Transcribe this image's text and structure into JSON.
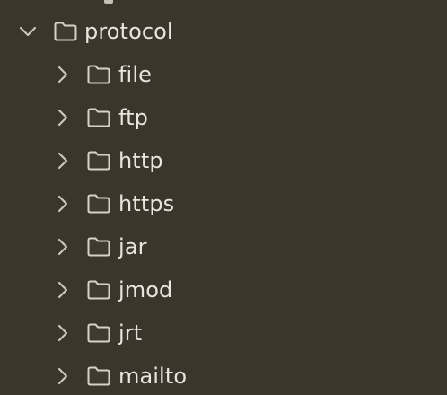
{
  "parent_folder": {
    "name": "protocol",
    "expanded": true,
    "icon": "folder-icon",
    "toggle_icon": "chevron-down-icon"
  },
  "children": [
    {
      "name": "file",
      "expanded": false,
      "icon": "folder-icon",
      "toggle_icon": "chevron-right-icon"
    },
    {
      "name": "ftp",
      "expanded": false,
      "icon": "folder-icon",
      "toggle_icon": "chevron-right-icon"
    },
    {
      "name": "http",
      "expanded": false,
      "icon": "folder-icon",
      "toggle_icon": "chevron-right-icon"
    },
    {
      "name": "https",
      "expanded": false,
      "icon": "folder-icon",
      "toggle_icon": "chevron-right-icon"
    },
    {
      "name": "jar",
      "expanded": false,
      "icon": "folder-icon",
      "toggle_icon": "chevron-right-icon"
    },
    {
      "name": "jmod",
      "expanded": false,
      "icon": "folder-icon",
      "toggle_icon": "chevron-right-icon"
    },
    {
      "name": "jrt",
      "expanded": false,
      "icon": "folder-icon",
      "toggle_icon": "chevron-right-icon"
    },
    {
      "name": "mailto",
      "expanded": false,
      "icon": "folder-icon",
      "toggle_icon": "chevron-right-icon"
    }
  ],
  "colors": {
    "background": "#3c352c",
    "text": "#e9e5de",
    "arrow": "#cbc5bc",
    "folder_stroke": "#d7d1c8"
  }
}
